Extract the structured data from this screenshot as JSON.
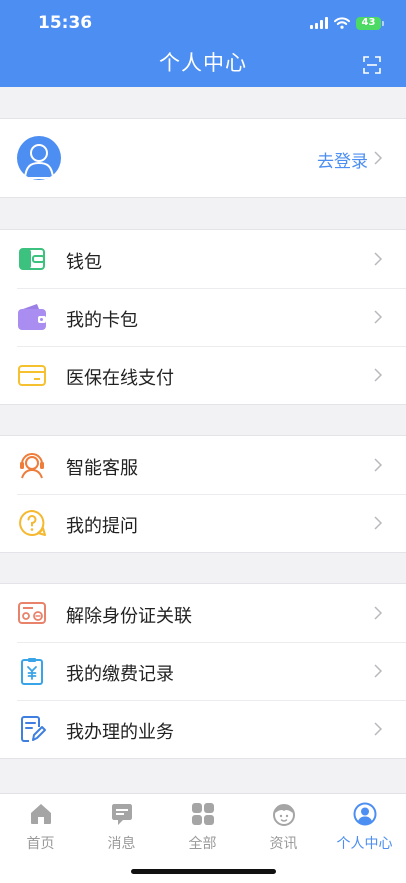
{
  "status_bar": {
    "time": "15:36",
    "battery": "43"
  },
  "header": {
    "title": "个人中心",
    "scan_icon": "scan-icon"
  },
  "profile": {
    "login_label": "去登录",
    "avatar_icon": "user-avatar-icon"
  },
  "groups": [
    {
      "items": [
        {
          "label": "钱包",
          "icon": "wallet-icon"
        },
        {
          "label": "我的卡包",
          "icon": "card-holder-icon"
        },
        {
          "label": "医保在线支付",
          "icon": "medical-card-icon"
        }
      ]
    },
    {
      "items": [
        {
          "label": "智能客服",
          "icon": "headset-icon"
        },
        {
          "label": "我的提问",
          "icon": "question-icon"
        }
      ]
    },
    {
      "items": [
        {
          "label": "解除身份证关联",
          "icon": "id-card-icon"
        },
        {
          "label": "我的缴费记录",
          "icon": "payment-record-icon"
        },
        {
          "label": "我办理的业务",
          "icon": "business-record-icon"
        }
      ]
    }
  ],
  "tabbar": {
    "items": [
      {
        "label": "首页",
        "icon": "home-icon"
      },
      {
        "label": "消息",
        "icon": "message-icon"
      },
      {
        "label": "全部",
        "icon": "grid-icon"
      },
      {
        "label": "资讯",
        "icon": "news-icon"
      },
      {
        "label": "个人中心",
        "icon": "profile-icon"
      }
    ],
    "active_index": 4
  },
  "colors": {
    "primary": "#4c8ef1",
    "background": "#f2f2f4",
    "inactive": "#9a9a9a"
  }
}
